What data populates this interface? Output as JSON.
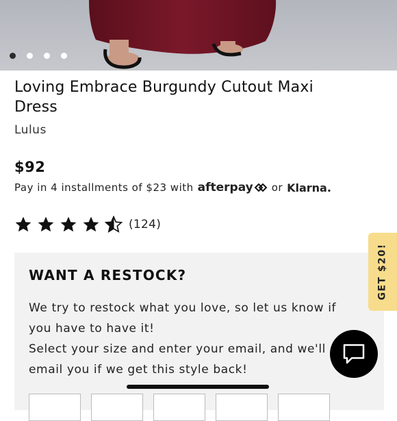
{
  "gallery": {
    "image_icon": "product-photo-burgundy-dress",
    "slide_count": 4,
    "active_slide": 1
  },
  "product": {
    "title": "Loving Embrace Burgundy Cutout Maxi Dress",
    "brand": "Lulus",
    "price": "$92"
  },
  "installments": {
    "text": "Pay in 4 installments of $23 with",
    "provider_1": "afterpay",
    "separator": "or",
    "provider_2": "Klarna."
  },
  "rating": {
    "stars": 4.5,
    "max_stars": 5,
    "count_text": "(124)"
  },
  "restock": {
    "title": "WANT A RESTOCK?",
    "line_1": "We try to restock what you love, so let us know if you have to have it!",
    "line_2": "Select your size and enter your email, and we'll email you if we get this style back!"
  },
  "promo_tab": {
    "label": "GET $20!"
  },
  "chat": {
    "icon": "chat-bubble-icon"
  },
  "colors": {
    "dress": "#6e1424",
    "promo_tab": "#f7dc8c",
    "restock_bg": "#f2f2f2",
    "hero_bg": "#b9bcc3"
  }
}
